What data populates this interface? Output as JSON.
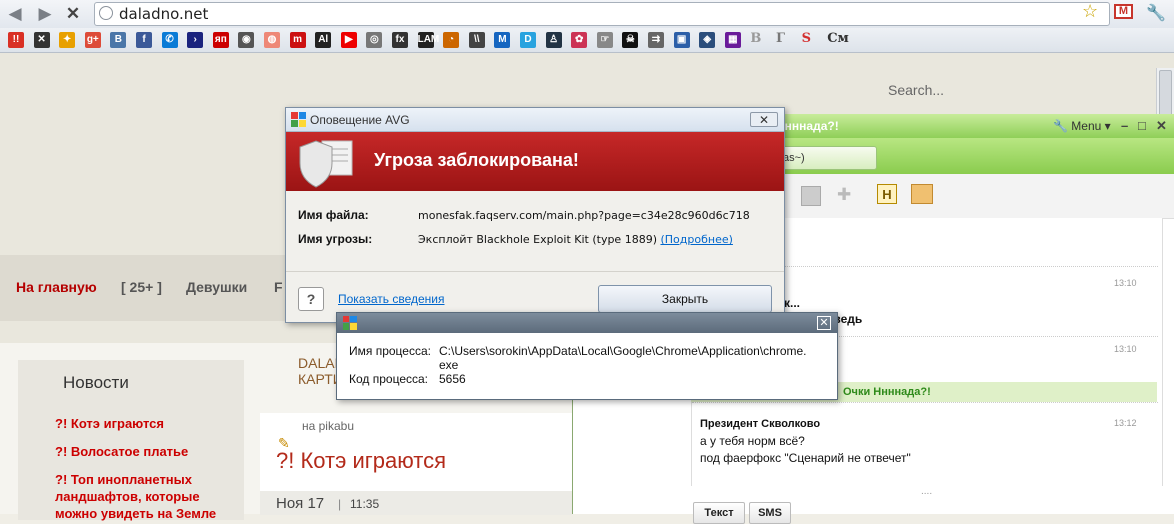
{
  "browser": {
    "url": "daladno.net",
    "bookmarks": [
      "!!",
      "✕",
      "✦",
      "g+",
      "B",
      "f",
      "✆",
      "›",
      "яп",
      "◉",
      "◍",
      "m",
      "Al",
      "▶",
      "◎",
      "fx",
      "LAM",
      "◔",
      "\\\\",
      "M",
      "D",
      "♙",
      "✿",
      "☞",
      "☠",
      "⇉",
      "▣",
      "◈",
      "▦",
      "B",
      "Г",
      "S",
      "См"
    ],
    "bookmark_colors": [
      "#d93025",
      "#333",
      "#e8a000",
      "#dd4b39",
      "#4a76a8",
      "#3b5998",
      "#0a7bd6",
      "#1a237e",
      "#c00",
      "#555",
      "#e87",
      "#c11",
      "#222",
      "#e00",
      "#777",
      "#333",
      "#222",
      "#c60",
      "#444",
      "#1565c0",
      "#29a3df",
      "#234",
      "#c35",
      "#888",
      "#111",
      "#666",
      "#2c5fa8",
      "#2b4e7c",
      "#6a1b9a",
      "#999",
      "#777",
      "#d32f2f",
      "#333"
    ]
  },
  "page": {
    "search_label": "Search...",
    "nav": [
      "На главную",
      "[ 25+ ]",
      "Девушки",
      "F"
    ],
    "news_header": "Новости",
    "news_items": [
      "?! Котэ играются",
      "?! Волосатое платье",
      "?! Топ инопланетных ландшафтов, которые можно увидеть на Земле"
    ],
    "dalad_line1": "DALAD",
    "dalad_line2": "КАРТИ",
    "article_source": "на pikabu",
    "article_title": "?! Котэ играются",
    "article_date": "Ноя 17",
    "article_time": "11:35"
  },
  "chat": {
    "title": "Ннннада?!",
    "menu": "Menu",
    "tab_label": "skas~)",
    "toolbar_h": "H",
    "ts1": "13:10",
    "msg_partial1": "к...",
    "msg_partial2": "дет ведь",
    "ts2": "13:10",
    "green_label": "Очки Ннннада?!",
    "sender": "Президент Скволково",
    "ts3": "13:12",
    "line1": "а у тебя норм всё?",
    "line2": "под фаерфокс \"Сценарий не отвечет\"",
    "dots": "....",
    "btn_text": "Текст",
    "btn_sms": "SMS"
  },
  "avg": {
    "title": "Оповещение AVG",
    "close_x": "✕",
    "threat_title": "Угроза заблокирована!",
    "file_label": "Имя файла:",
    "file_value": "monesfak.faqserv.com/main.php?page=c34e28c960d6c718",
    "threat_label": "Имя угрозы:",
    "threat_value": "Эксплойт Blackhole Exploit Kit (type 1889)",
    "more_link": "(Подробнее)",
    "help": "?",
    "show_details": "Показать сведения",
    "close_button": "Закрыть",
    "banner_color": "#b71c1c"
  },
  "process": {
    "close_x": "✕",
    "path_label": "Имя процесса:",
    "path_value_1": "C:\\Users\\sorokin\\AppData\\Local\\Google\\Chrome\\Application\\chrome.",
    "path_value_2": "exe",
    "code_label": "Код процесса:",
    "code_value": "5656"
  }
}
